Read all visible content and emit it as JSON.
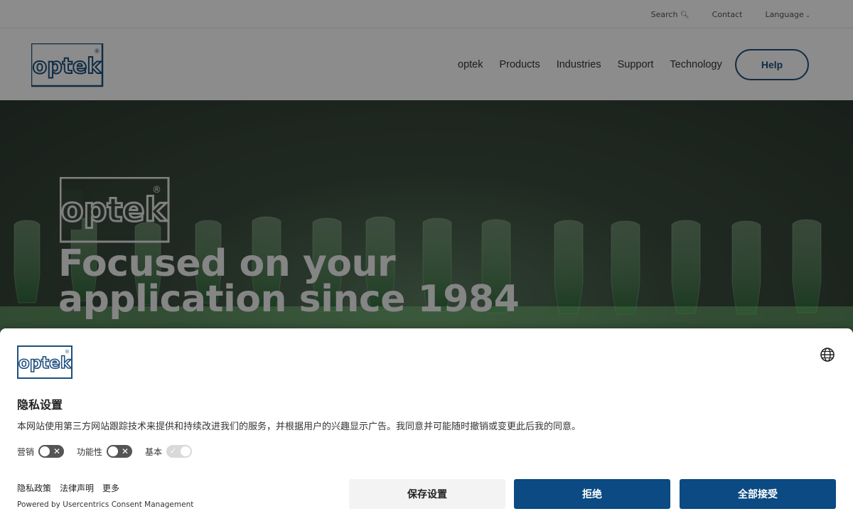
{
  "topbar": {
    "search_label": "Search",
    "contact_label": "Contact",
    "language_label": "Language"
  },
  "nav": {
    "items": [
      "optek",
      "Products",
      "Industries",
      "Support",
      "Technology"
    ],
    "help_label": "Help"
  },
  "logo": {
    "text": "optek",
    "registered": "®"
  },
  "hero": {
    "title_line1": "Focused on your",
    "title_line2": "application since 1984"
  },
  "consent": {
    "title": "隐私设置",
    "description": "本网站使用第三方网站跟踪技术来提供和持续改进我们的服务，并根据用户的兴趣显示广告。我同意并可能随时撤销或变更此后我的同意。",
    "toggles": [
      {
        "label": "营销",
        "state": "off"
      },
      {
        "label": "功能性",
        "state": "off"
      },
      {
        "label": "基本",
        "state": "on",
        "disabled": true
      }
    ],
    "links": [
      "隐私政策",
      "法律声明",
      "更多"
    ],
    "powered_by": "Powered by Usercentrics Consent Management",
    "buttons": {
      "save": "保存设置",
      "deny": "拒绝",
      "accept": "全部接受"
    }
  },
  "colors": {
    "brand_blue": "#1e4f7f",
    "button_blue": "#0b4a82",
    "toggle_off": "#555555"
  }
}
